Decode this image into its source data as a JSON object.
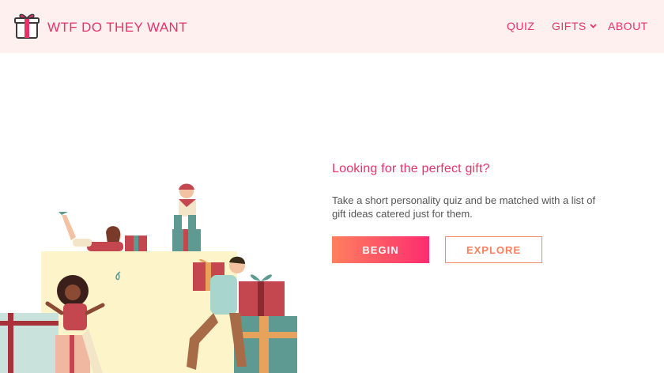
{
  "header": {
    "brand": "WTF DO THEY WANT",
    "logo_icon": "gift-box-icon",
    "nav": {
      "quiz": "QUIZ",
      "gifts": "GIFTS",
      "about": "ABOUT"
    }
  },
  "hero": {
    "headline": "Looking for the perfect gift?",
    "description": "Take a short personality quiz and be matched with a list of gift ideas catered just for them.",
    "begin_label": "BEGIN",
    "explore_label": "EXPLORE",
    "illustration_icon": "people-with-gifts-illustration"
  },
  "colors": {
    "accent": "#e8336a",
    "header_bg": "#fdf0ef",
    "button_gradient_start": "#ff7f5e",
    "button_gradient_end": "#fc2d6f"
  }
}
